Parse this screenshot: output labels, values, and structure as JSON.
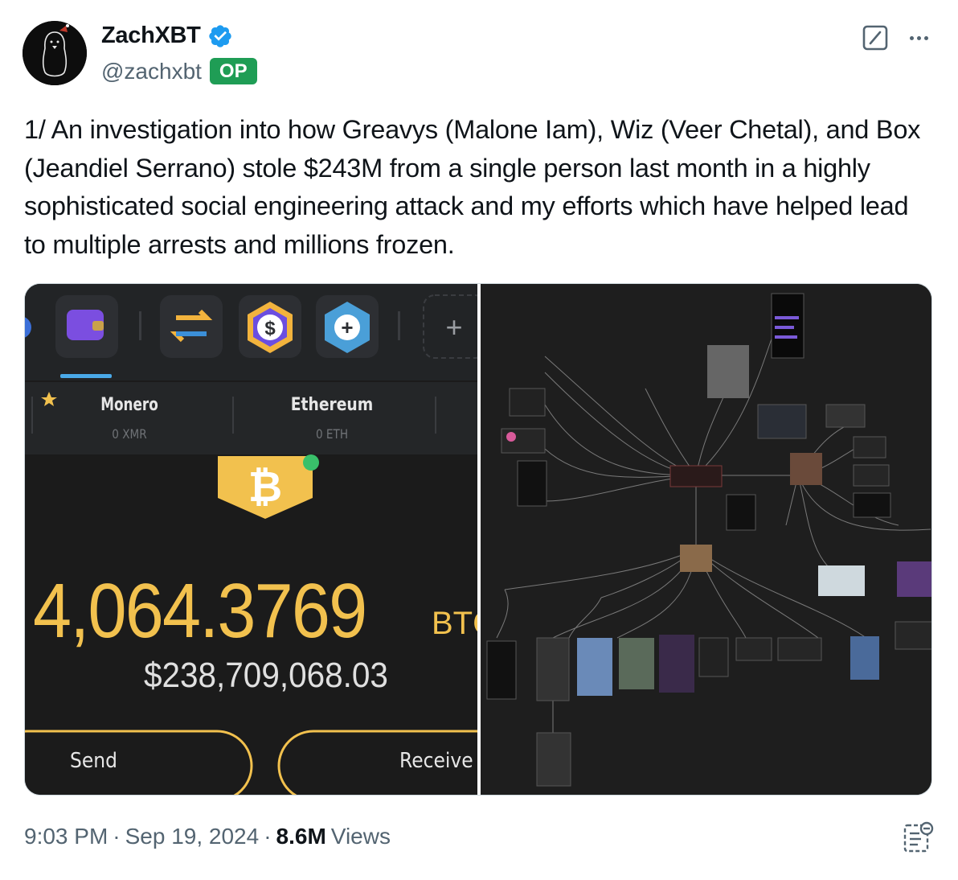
{
  "author": {
    "display_name": "ZachXBT",
    "handle": "@zachxbt",
    "badge": "OP",
    "verified": true,
    "avatar_icon": "penguin-avatar-icon"
  },
  "tweet": {
    "text": "1/ An investigation into how Greavys (Malone Iam), Wiz (Veer Chetal), and Box (Jeandiel Serrano) stole $243M from a single person last month in a highly sophisticated social engineering attack and my efforts which have helped lead to multiple arrests and millions frozen."
  },
  "media": {
    "wallet": {
      "assets": [
        {
          "name": "Monero",
          "amount": "0 XMR"
        },
        {
          "name": "Ethereum",
          "amount": "0 ETH"
        }
      ],
      "balance_btc": "4,064.3769",
      "balance_unit": "BTC",
      "balance_usd": "$238,709,068.03",
      "send_label": "Send",
      "receive_label": "Receive"
    }
  },
  "footer": {
    "time": "9:03 PM",
    "date": "Sep 19, 2024",
    "separator": "·",
    "views_count": "8.6M",
    "views_label": "Views"
  },
  "colors": {
    "verified_blue": "#1d9bf0",
    "op_green": "#1f9d55",
    "wallet_gold": "#f2c14e",
    "secondary_text": "#536471"
  }
}
